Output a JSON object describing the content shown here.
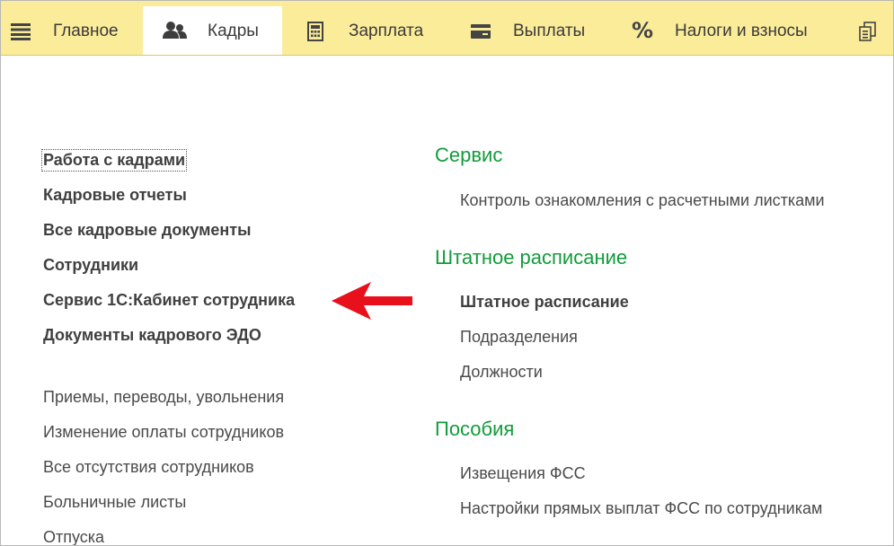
{
  "nav": {
    "tabs": [
      {
        "label": "Главное",
        "icon": "menu-icon",
        "active": false
      },
      {
        "label": "Кадры",
        "icon": "people-icon",
        "active": true
      },
      {
        "label": "Зарплата",
        "icon": "calculator-icon",
        "active": false
      },
      {
        "label": "Выплаты",
        "icon": "card-icon",
        "active": false
      },
      {
        "label": "Налоги и взносы",
        "icon": "percent-icon",
        "icon_glyph": "%",
        "active": false
      },
      {
        "label": "",
        "icon": "documents-icon",
        "active": false
      }
    ]
  },
  "left_panel": {
    "primary_links": [
      "Работа с кадрами",
      "Кадровые отчеты",
      "Все кадровые документы",
      "Сотрудники",
      "Сервис 1С:Кабинет сотрудника",
      "Документы кадрового ЭДО"
    ],
    "secondary_links": [
      "Приемы, переводы, увольнения",
      "Изменение оплаты сотрудников",
      "Все отсутствия сотрудников",
      "Больничные листы",
      "Отпуска"
    ]
  },
  "right_panel": {
    "sections": [
      {
        "title": "Сервис",
        "items": [
          {
            "label": "Контроль ознакомления с расчетными листками",
            "bold": false
          }
        ]
      },
      {
        "title": "Штатное расписание",
        "items": [
          {
            "label": "Штатное расписание",
            "bold": true
          },
          {
            "label": "Подразделения",
            "bold": false
          },
          {
            "label": "Должности",
            "bold": false
          }
        ]
      },
      {
        "title": "Пособия",
        "items": [
          {
            "label": "Извещения ФСС",
            "bold": false
          },
          {
            "label": "Настройки прямых выплат ФСС по сотрудникам",
            "bold": false
          }
        ]
      }
    ]
  },
  "colors": {
    "topbar_bg": "#fbec9a",
    "section_title": "#119c3a",
    "arrow": "#e8101a"
  }
}
